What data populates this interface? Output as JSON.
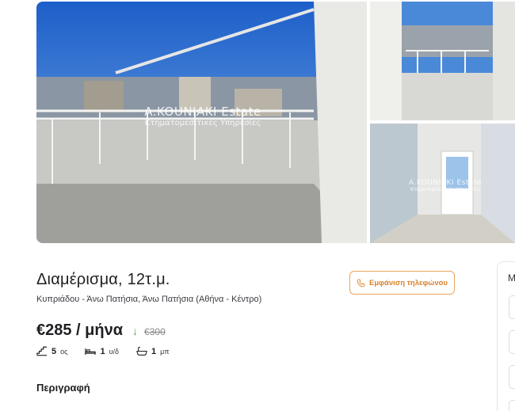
{
  "gallery": {
    "watermark_brand": "A.KOUNIAKI Estate",
    "watermark_sub": "Κτηματομεσιτικές Υπηρεσίες"
  },
  "listing": {
    "title": "Διαμέρισμα, 12τ.μ.",
    "address": "Κυπριάδου - Άνω Πατήσια, Άνω Πατήσια (Αθήνα - Κέντρο)",
    "phone_button_label": "Εμφάνιση τηλεφώνου",
    "price": "€285 / μήνα",
    "price_trend_icon": "arrow-down-icon",
    "old_price": "€300",
    "features": [
      {
        "icon": "stairs-icon",
        "value": "5",
        "unit": "ος"
      },
      {
        "icon": "bed-icon",
        "value": "1",
        "unit": "υ/δ"
      },
      {
        "icon": "bathtub-icon",
        "value": "1",
        "unit": "μπ"
      }
    ],
    "description_heading": "Περιγραφή"
  },
  "side_panel": {
    "heading_initial": "Μ"
  },
  "colors": {
    "accent_orange": "#d9822b",
    "price_down_green": "#4caf50"
  }
}
